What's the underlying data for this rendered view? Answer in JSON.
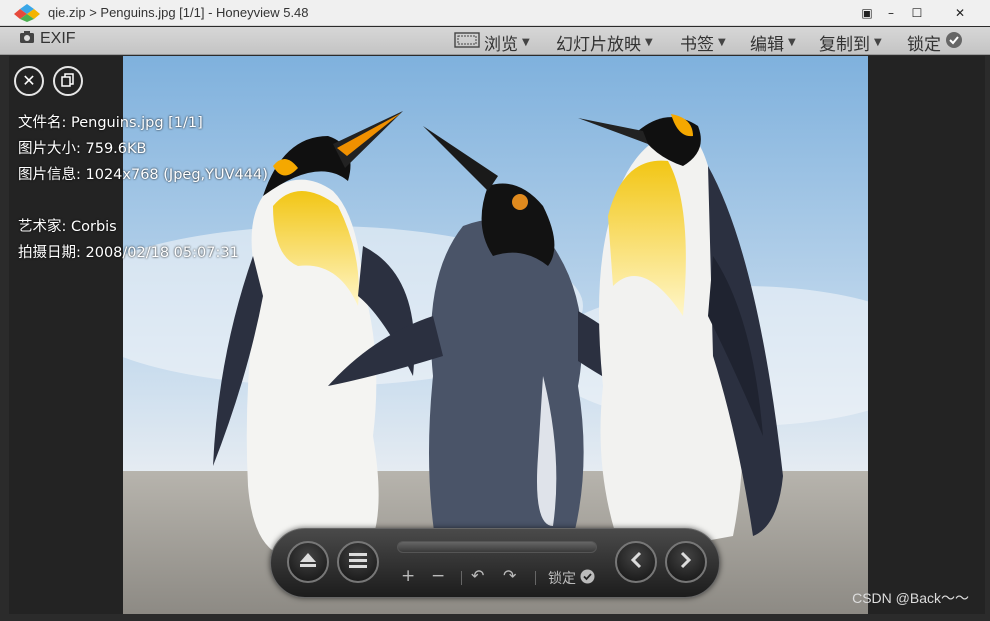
{
  "window": {
    "title": "qie.zip > Penguins.jpg [1/1] - Honeyview 5.48"
  },
  "toolbar": {
    "exif_label": "EXIF",
    "menu": [
      {
        "label": "浏览"
      },
      {
        "label": "幻灯片放映"
      },
      {
        "label": "书签"
      },
      {
        "label": "编辑"
      },
      {
        "label": "复制到"
      }
    ],
    "lock_label": "锁定"
  },
  "info": {
    "filename": "文件名: Penguins.jpg [1/1]",
    "filesize": "图片大小: 759.6KB",
    "imageinfo": "图片信息: 1024x768 (Jpeg,YUV444)",
    "artist": "艺术家: Corbis",
    "date": "拍摄日期: 2008/02/18 05:07:31"
  },
  "controls": {
    "lock_label": "锁定",
    "plus": "+",
    "minus": "−"
  },
  "watermark": "CSDN @Back～～"
}
